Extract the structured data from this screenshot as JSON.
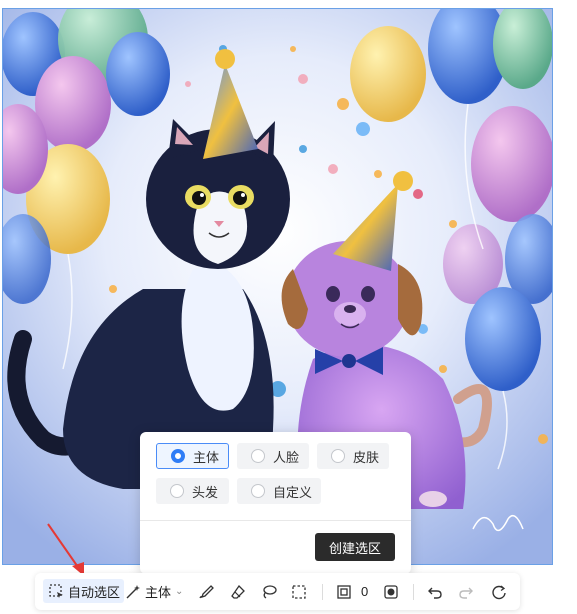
{
  "popup": {
    "options": [
      {
        "label": "主体",
        "selected": true
      },
      {
        "label": "人脸",
        "selected": false
      },
      {
        "label": "皮肤",
        "selected": false
      },
      {
        "label": "头发",
        "selected": false
      },
      {
        "label": "自定义",
        "selected": false
      }
    ],
    "create_button": "创建选区"
  },
  "toolbar": {
    "auto_select_label": "自动选区",
    "subject_label": "主体",
    "feather_value": "0",
    "icons": [
      "dashed-select-icon",
      "magic-wand-icon",
      "chevron-down-icon",
      "brush-icon",
      "eraser-icon",
      "lasso-icon",
      "rect-select-icon",
      "feather-icon",
      "invert-icon",
      "undo-icon",
      "redo-icon",
      "reset-icon"
    ]
  },
  "colors": {
    "accent": "#2f7df6",
    "canvas_border": "#6aa0e6",
    "button_dark": "#2b2b2b",
    "annotation_arrow": "#e53935"
  }
}
